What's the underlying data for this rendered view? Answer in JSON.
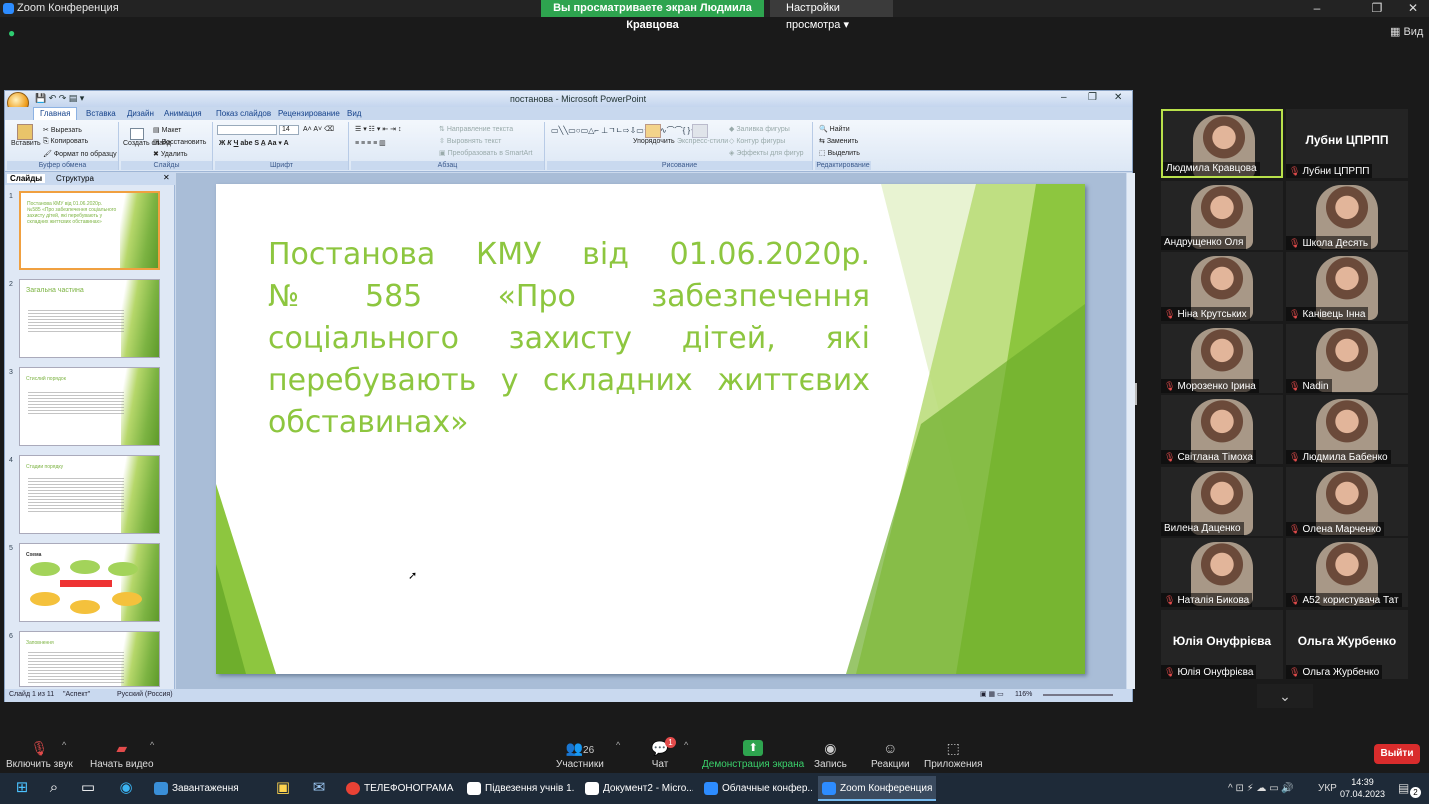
{
  "titlebar": {
    "app_title": "Zoom Конференция",
    "share_banner": "Вы просматриваете экран Людмила Кравцова",
    "view_options": "Настройки просмотра",
    "view_btn": "Вид"
  },
  "ppt": {
    "window_title": "постанова - Microsoft PowerPoint",
    "tabs": [
      "Главная",
      "Вставка",
      "Дизайн",
      "Анимация",
      "Показ слайдов",
      "Рецензирование",
      "Вид"
    ],
    "clipboard": {
      "paste": "Вставить",
      "cut": "Вырезать",
      "copy": "Копировать",
      "format": "Формат по образцу",
      "label": "Буфер обмена"
    },
    "slides_grp": {
      "create": "Создать слайд",
      "layout": "Макет",
      "restore": "Восстановить",
      "delete": "Удалить",
      "label": "Слайды"
    },
    "font_grp": {
      "size": "14",
      "label": "Шрифт"
    },
    "para_grp": {
      "direction": "Направление текста",
      "align": "Выровнять текст",
      "smartart": "Преобразовать в SmartArt",
      "label": "Абзац"
    },
    "draw_grp": {
      "arrange": "Упорядочить",
      "styles": "Экспресс-стили",
      "fill": "Заливка фигуры",
      "outline": "Контур фигуры",
      "effects": "Эффекты для фигур",
      "label": "Рисование"
    },
    "edit_grp": {
      "find": "Найти",
      "replace": "Заменить",
      "select": "Выделить",
      "label": "Редактирование"
    },
    "left_tabs": [
      "Слайды",
      "Структура"
    ],
    "thumbs": [
      {
        "num": "1",
        "text": "Постанова КМУ від 01.06.2020р. №585 «Про забезпечення соціального захисту дітей, які перебувають у складних життєвих обставинах»"
      },
      {
        "num": "2",
        "text": "Загальна частина"
      },
      {
        "num": "3",
        "text": "Стислий порядок"
      },
      {
        "num": "4",
        "text": "Стадии порядку"
      },
      {
        "num": "5",
        "text": "Схема"
      },
      {
        "num": "6",
        "text": "Заповнення"
      }
    ],
    "slide_title": "Постанова КМУ від 01.06.2020р. №585 «Про забезпечення соціального захисту дітей, які перебувають у складних життєвих обставинах»",
    "status": {
      "slide": "Слайд 1 из 11",
      "theme": "\"Аспект\"",
      "lang": "Русский (Россия)",
      "zoom": "116%"
    }
  },
  "participants": [
    {
      "name": "Людмила Кравцова",
      "video": true,
      "muted": false,
      "speaking": true
    },
    {
      "name": "Лубни ЦПРПП",
      "video": false,
      "muted": true
    },
    {
      "name": "Андрущенко Оля",
      "video": true,
      "muted": false
    },
    {
      "name": "Школа Десять",
      "video": true,
      "muted": true
    },
    {
      "name": "Ніна Крутських",
      "video": true,
      "muted": true
    },
    {
      "name": "Канівець Інна",
      "video": true,
      "muted": true
    },
    {
      "name": "Морозенко Ірина",
      "video": true,
      "muted": true
    },
    {
      "name": "Nadin",
      "video": true,
      "muted": true
    },
    {
      "name": "Світлана Тімоха",
      "video": true,
      "muted": true
    },
    {
      "name": "Людмила Бабенко",
      "video": true,
      "muted": true
    },
    {
      "name": "Вилена Даценко",
      "video": true,
      "muted": false
    },
    {
      "name": "Олена Марченко",
      "video": true,
      "muted": true
    },
    {
      "name": "Наталія Бикова",
      "video": true,
      "muted": true
    },
    {
      "name": "А52 користувача Тат",
      "video": true,
      "muted": true
    },
    {
      "name": "Юлія Онуфрієва",
      "video": false,
      "muted": true
    },
    {
      "name": "Ольга Журбенко",
      "video": false,
      "muted": true
    }
  ],
  "toolbar": {
    "unmute": "Включить звук",
    "start_video": "Начать видео",
    "participants_count": "26",
    "participants": "Участники",
    "chat": "Чат",
    "chat_badge": "1",
    "share": "Демонстрация экрана",
    "record": "Запись",
    "reactions": "Реакции",
    "apps": "Приложения",
    "leave": "Выйти"
  },
  "taskbar": {
    "apps": [
      "Завантаження",
      "",
      "",
      "ТЕЛЕФОНОГРАМА...",
      "Підвезення учнів 1...",
      "Документ2 - Micro...",
      "Облачные конфер...",
      "Zoom Конференция"
    ],
    "lang": "УКР",
    "time": "14:39",
    "date": "07.04.2023",
    "notif": "2"
  },
  "colors": {
    "slide_green": "#8dc63f",
    "share_green": "#2ea44f",
    "leave_red": "#d92c2c"
  }
}
